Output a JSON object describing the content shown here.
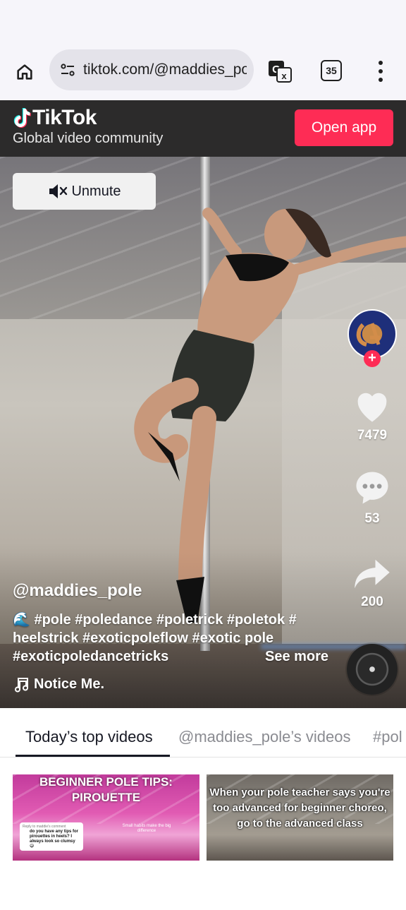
{
  "browser": {
    "url": "tiktok.com/@maddies_po",
    "tab_count": "35",
    "icons": {
      "home": "home-icon",
      "site_settings": "tune-icon",
      "translate": "translate-icon",
      "menu": "more-vert-icon"
    }
  },
  "banner": {
    "brand": "TikTok",
    "tagline": "Global video community",
    "open_app": "Open app",
    "accent": "#fe2c55"
  },
  "video": {
    "unmute_label": "Unmute",
    "username": "@maddies_pole",
    "description": "🌊 #pole #poledance #poletrick #poletok # heelstrick #exoticpoleflow #exotic pole #exoticpoledancetricks",
    "see_more": "See more",
    "music": "Notice Me.",
    "likes": "7479",
    "comments": "53",
    "shares": "200"
  },
  "tabs": [
    {
      "label": "Today’s top videos"
    },
    {
      "label": "@maddies_pole’s videos"
    },
    {
      "label": "#pol"
    }
  ],
  "thumbnails": [
    {
      "title": "BEGINNER POLE TIPS: PIROUETTE",
      "reply_header": "Reply to maddie's comment",
      "reply_body": "do you have any tips for pirouettes in heels? I always look so clumsy 😅",
      "overlay": "Small habits make the big difference"
    },
    {
      "title": "When your pole teacher says you're too advanced for beginner choreo, go to the advanced class"
    }
  ]
}
